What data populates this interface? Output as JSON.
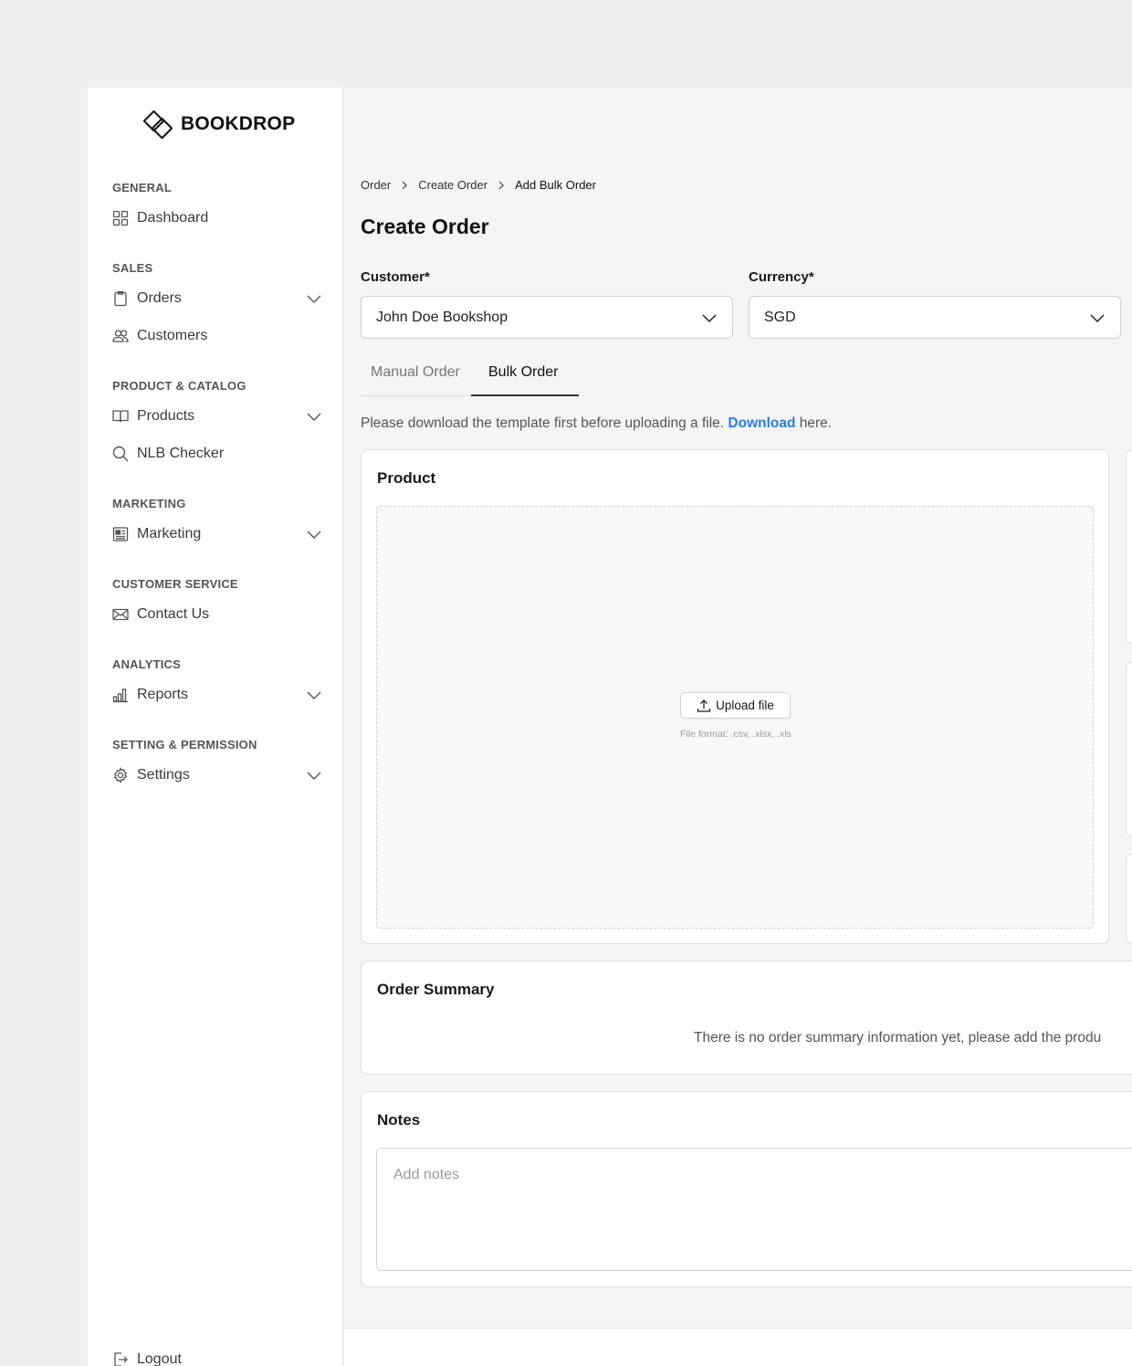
{
  "app": {
    "brand": "BOOKDROP"
  },
  "sidebar": {
    "sections": [
      {
        "title": "GENERAL",
        "items": [
          {
            "label": "Dashboard",
            "icon": "grid-icon",
            "expandable": false
          }
        ]
      },
      {
        "title": "SALES",
        "items": [
          {
            "label": "Orders",
            "icon": "clipboard-icon",
            "expandable": true
          },
          {
            "label": "Customers",
            "icon": "users-icon",
            "expandable": false
          }
        ]
      },
      {
        "title": "PRODUCT & CATALOG",
        "items": [
          {
            "label": "Products",
            "icon": "book-icon",
            "expandable": true
          },
          {
            "label": "NLB Checker",
            "icon": "search-icon",
            "expandable": false
          }
        ]
      },
      {
        "title": "MARKETING",
        "items": [
          {
            "label": "Marketing",
            "icon": "newspaper-icon",
            "expandable": true
          }
        ]
      },
      {
        "title": "CUSTOMER SERVICE",
        "items": [
          {
            "label": "Contact Us",
            "icon": "mail-icon",
            "expandable": false
          }
        ]
      },
      {
        "title": "ANALYTICS",
        "items": [
          {
            "label": "Reports",
            "icon": "bar-chart-icon",
            "expandable": true
          }
        ]
      },
      {
        "title": "SETTING & PERMISSION",
        "items": [
          {
            "label": "Settings",
            "icon": "gear-icon",
            "expandable": true
          }
        ]
      }
    ],
    "logout_label": "Logout"
  },
  "breadcrumb": [
    "Order",
    "Create Order",
    "Add Bulk Order"
  ],
  "page_title": "Create Order",
  "form": {
    "customer_label": "Customer*",
    "customer_value": "John Doe Bookshop",
    "currency_label": "Currency*",
    "currency_value": "SGD"
  },
  "tabs": [
    {
      "label": "Manual Order",
      "active": false
    },
    {
      "label": "Bulk Order",
      "active": true
    }
  ],
  "hint": {
    "before": "Please download the template first before uploading a file. ",
    "link": "Download",
    "after": " here."
  },
  "product_card": {
    "title": "Product",
    "upload_label": "Upload file",
    "file_format": "File format: .csv, .xlsx, .xls"
  },
  "order_summary": {
    "title": "Order Summary",
    "empty_text": "There is no order summary information yet, please add the produ"
  },
  "notes": {
    "title": "Notes",
    "placeholder": "Add notes"
  },
  "colors": {
    "accent_link": "#2f7be0",
    "sidebar_bg": "#ffffff",
    "page_bg": "#f5f5f5"
  }
}
